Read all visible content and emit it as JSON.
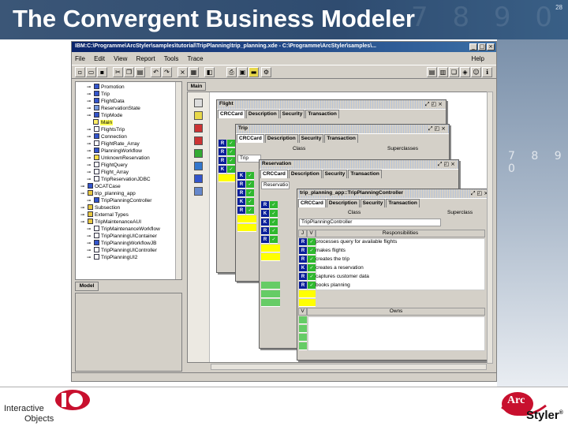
{
  "slide": {
    "title": "The Convergent Business Modeler",
    "page_number": "28",
    "bg_digits": "7 8 9 0"
  },
  "app": {
    "window_title": "IBM:C:\\Programme\\ArcStyler\\samples\\tutorial\\TripPlanning\\trip_planning.xde - C:\\Programme\\ArcStyler\\samples\\...",
    "menu": [
      "File",
      "Edit",
      "View",
      "Report",
      "Tools",
      "Trace"
    ],
    "help": "Help",
    "tree_items": [
      "Promotion",
      "Trip",
      "FlightData",
      "ReservationState",
      "TripMode",
      "Main",
      "FlightsTrip",
      "Connection",
      "FlightRate_Array",
      "PlanningWorkflow",
      "UnknownReservation",
      "FlightQuery",
      "Flight_Array",
      "TripReservationJDBC",
      "OCATCase",
      "trip_planning_app",
      "TripPlanningController",
      "Subsection",
      "External Types",
      "TripMaintenanceAUI",
      "TripMaintenanceWorkflow",
      "TripPlanningUIContainer",
      "TripPlanningWorkflowJB",
      "TripPlanningUIController",
      "TripPlanningUI2"
    ],
    "tree_tab": "Model",
    "main_tab": "Main"
  },
  "windows": {
    "flight": {
      "title": "Flight",
      "tabs": [
        "CRCCard",
        "Description",
        "Security",
        "Transaction"
      ]
    },
    "trip": {
      "title": "Trip",
      "tabs": [
        "CRCCard",
        "Description",
        "Security",
        "Transaction"
      ],
      "class_label": "Class",
      "superclass_label": "Superclasses",
      "field": "Trip"
    },
    "reservation": {
      "title": "Reservation",
      "tabs": [
        "CRCCard",
        "Description",
        "Security",
        "Transaction"
      ],
      "class_label": "Class",
      "field": "Reservatio"
    },
    "controller": {
      "title": "trip_planning_app::TripPlanningController",
      "tabs": [
        "CRCCard",
        "Description",
        "Security",
        "Transaction"
      ],
      "class_label": "Class",
      "superclass_label": "Superclass",
      "class_value": "TripPlanningController",
      "j_label": "J",
      "v_label": "V",
      "resp_header": "Responsibilities",
      "owns_header": "Owns",
      "responsibilities": [
        "processes query for available flights",
        "makes flights",
        "creates the trip",
        "creates a reservation",
        "captures customer data",
        "books planning"
      ],
      "j_values": [
        "R",
        "R",
        "R",
        "K",
        "R",
        "R"
      ]
    }
  },
  "footer": {
    "left_line1": "Interactive",
    "left_line2": "Objects",
    "right_brand": "Styler",
    "right_arc": "Arc"
  },
  "colors": {
    "header": "#2f4c70",
    "j_cell": "#0a1f9a",
    "v_cell": "#2fb82f",
    "highlight": "#ffff00",
    "io_red": "#c8102e"
  }
}
